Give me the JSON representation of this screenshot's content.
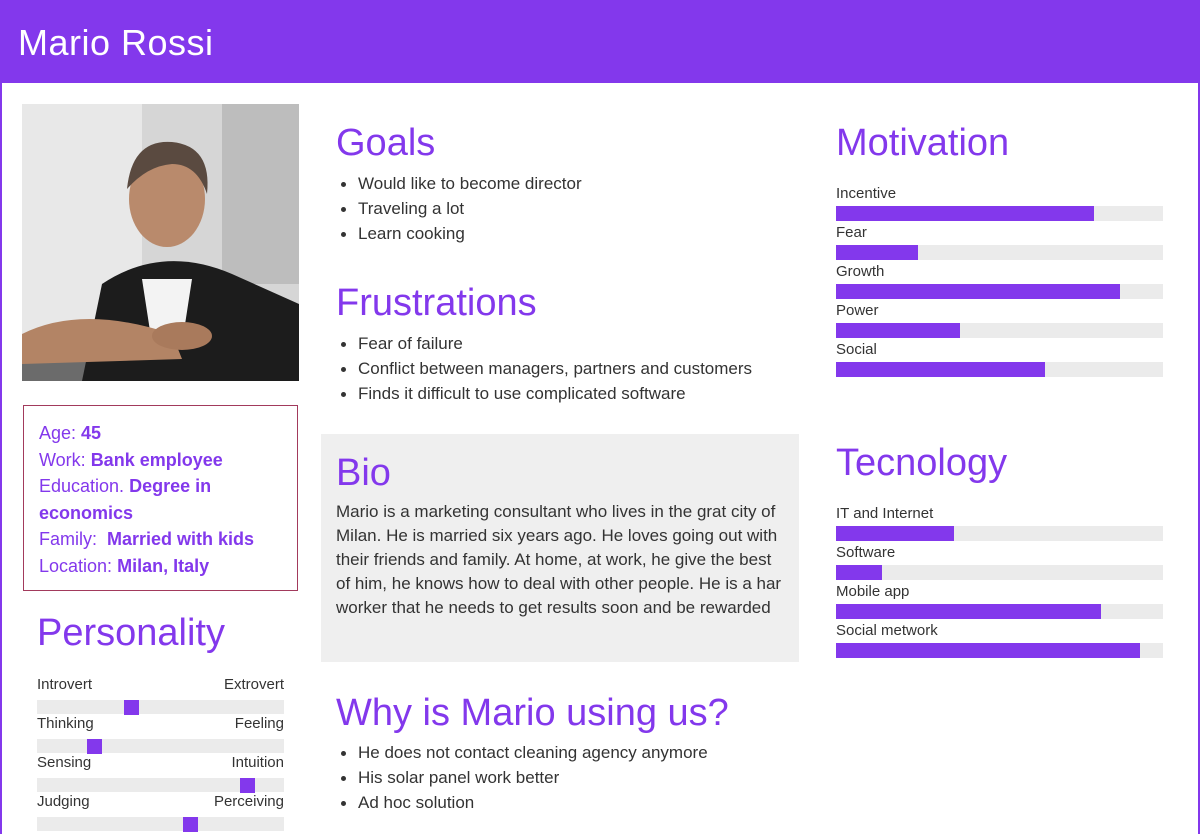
{
  "header": {
    "title": "Mario Rossi"
  },
  "profile": {
    "age_label": "Age:",
    "age": "45",
    "work_label": "Work:",
    "work": "Bank employee",
    "education_label": "Education.",
    "education": "Degree in economics",
    "family_label": "Family:",
    "family": "Married with kids",
    "location_label": "Location:",
    "location": "Milan, Italy"
  },
  "personality": {
    "title": "Personality",
    "scales": [
      {
        "left": "Introvert",
        "right": "Extrovert",
        "value": 0.38
      },
      {
        "left": "Thinking",
        "right": "Feeling",
        "value": 0.23
      },
      {
        "left": "Sensing",
        "right": "Intuition",
        "value": 0.85
      },
      {
        "left": "Judging",
        "right": "Perceiving",
        "value": 0.62
      }
    ]
  },
  "goals": {
    "title": "Goals",
    "items": [
      "Would like to become director",
      "Traveling a lot",
      "Learn cooking"
    ]
  },
  "frustrations": {
    "title": "Frustrations",
    "items": [
      "Fear of failure",
      "Conflict between managers, partners and customers",
      "Finds it difficult to use complicated software"
    ]
  },
  "bio": {
    "title": "Bio",
    "text": "Mario is a marketing consultant who lives in the grat city of Milan. He is married six years ago. He loves going out with their friends and family. At home, at work, he give the best of him, he knows how to deal with other people. He is a har worker that he needs to get results soon and be rewarded"
  },
  "why": {
    "title": "Why is Mario using us?",
    "items": [
      "He does not contact cleaning agency anymore",
      "His solar panel work better",
      "Ad hoc solution"
    ]
  },
  "motivation": {
    "title": "Motivation",
    "bars": [
      {
        "label": "Incentive",
        "value": 0.79
      },
      {
        "label": "Fear",
        "value": 0.25
      },
      {
        "label": "Growth",
        "value": 0.87
      },
      {
        "label": "Power",
        "value": 0.38
      },
      {
        "label": "Social",
        "value": 0.64
      }
    ]
  },
  "technology": {
    "title": "Tecnology",
    "bars": [
      {
        "label": "IT and Internet",
        "value": 0.36
      },
      {
        "label": "Software",
        "value": 0.14
      },
      {
        "label": "Mobile app",
        "value": 0.81
      },
      {
        "label": "Social metwork",
        "value": 0.93
      }
    ]
  },
  "colors": {
    "accent": "#8338ec",
    "track": "#ebebeb",
    "bio_bg": "#efefef",
    "info_border": "#a23a5c"
  }
}
